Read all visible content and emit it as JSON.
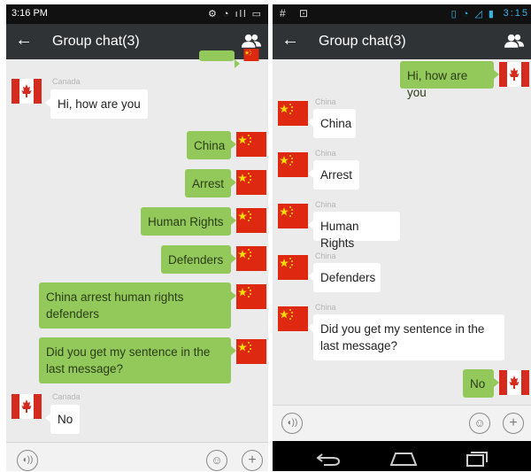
{
  "left": {
    "status": {
      "time": "3:16 PM",
      "icons_text": "⚙ ◔ ıll ▭"
    },
    "header": {
      "title": "Group chat(3)"
    },
    "messages": [
      {
        "from": "Canada",
        "text": "Hi, how are you"
      },
      {
        "from": "me",
        "text": "China"
      },
      {
        "from": "me",
        "text": "Arrest"
      },
      {
        "from": "me",
        "text": "Human Rights"
      },
      {
        "from": "me",
        "text": "Defenders"
      },
      {
        "from": "me",
        "text": "China arrest human rights defenders"
      },
      {
        "from": "me",
        "text": "Did you get my sentence in the last message?"
      },
      {
        "from": "Canada",
        "text": "No"
      }
    ]
  },
  "right": {
    "status": {
      "left_icons": "# ⊡",
      "time": "3:15",
      "icons_text": "▯ ◔ ◿ ▮"
    },
    "header": {
      "title": "Group chat(3)"
    },
    "messages": [
      {
        "from": "me",
        "text": "Hi, how are you"
      },
      {
        "from": "China",
        "text": "China"
      },
      {
        "from": "China",
        "text": "Arrest"
      },
      {
        "from": "China",
        "text": "Human Rights"
      },
      {
        "from": "China",
        "text": "Defenders"
      },
      {
        "from": "China",
        "text": "Did you get my sentence in the last message?"
      },
      {
        "from": "me",
        "text": "No"
      }
    ]
  },
  "colors": {
    "titlebar": "#303336",
    "bubble_out": "#93c95a",
    "china_red": "#de2910",
    "canada_red": "#d52b1e"
  },
  "icons": [
    "back-arrow-icon",
    "group-members-icon",
    "voice-icon",
    "emoji-icon",
    "plus-icon",
    "china-flag-icon",
    "canada-flag-icon"
  ]
}
